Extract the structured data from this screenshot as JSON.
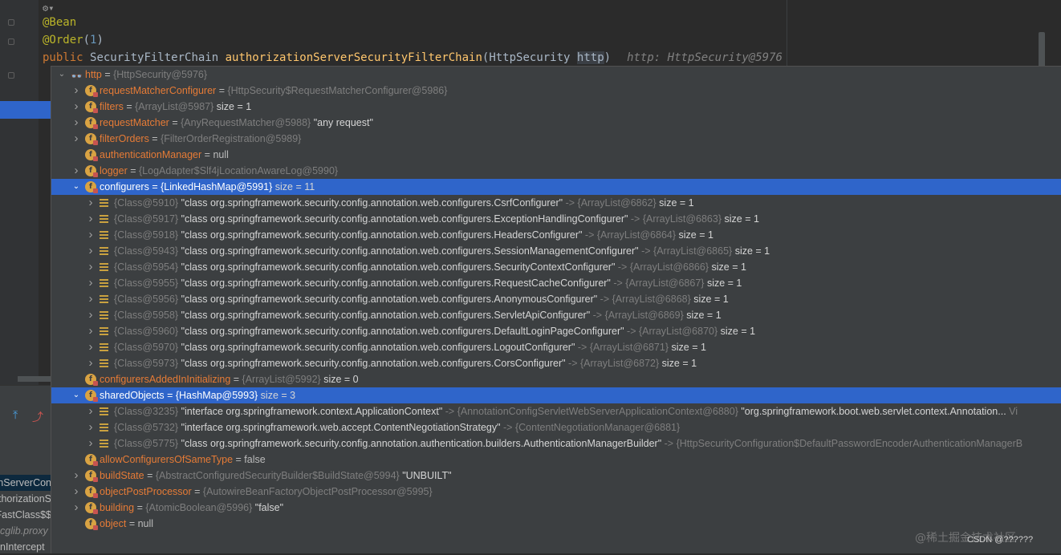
{
  "editor": {
    "lines": [
      {
        "id": "bean",
        "parts": [
          {
            "t": "@Bean",
            "c": "ann"
          }
        ]
      },
      {
        "id": "order",
        "parts": [
          {
            "t": "@Order",
            "c": "ann"
          },
          {
            "t": "(",
            "c": ""
          },
          {
            "t": "1",
            "c": "num"
          },
          {
            "t": ")",
            "c": ""
          }
        ]
      },
      {
        "id": "signature",
        "parts": [
          {
            "t": "public ",
            "c": "kw"
          },
          {
            "t": "SecurityFilterChain ",
            "c": ""
          },
          {
            "t": "authorizationServerSecurityFilterChain",
            "c": "fn"
          },
          {
            "t": "(HttpSecurity ",
            "c": ""
          },
          {
            "t": "http",
            "c": "param-hl"
          },
          {
            "t": ")",
            "c": ""
          },
          {
            "t": "http: HttpSecurity@5976",
            "c": "hint"
          }
        ]
      }
    ]
  },
  "stack_frames": [
    {
      "text": "nServerCon",
      "selected": true,
      "lib": false
    },
    {
      "text": "thorizationS",
      "selected": false,
      "lib": false
    },
    {
      "text": "FastClass$$",
      "selected": false,
      "lib": false
    },
    {
      "text": "cglib.proxy",
      "selected": false,
      "lib": true
    },
    {
      "text": "nIntercept",
      "selected": false,
      "lib": false
    }
  ],
  "tree": [
    {
      "depth": 0,
      "exp": "down",
      "icon": "glasses",
      "name": "http",
      "type": "{HttpSecurity@5976}",
      "tail": "",
      "sel": false
    },
    {
      "depth": 1,
      "exp": "right",
      "icon": "field",
      "name": "requestMatcherConfigurer",
      "type": "{HttpSecurity$RequestMatcherConfigurer@5986}",
      "tail": "",
      "sel": false
    },
    {
      "depth": 1,
      "exp": "right",
      "icon": "field",
      "name": "filters",
      "type": "{ArrayList@5987}",
      "tail": "size = 1",
      "sel": false
    },
    {
      "depth": 1,
      "exp": "right",
      "icon": "field",
      "name": "requestMatcher",
      "type": "{AnyRequestMatcher@5988}",
      "tail": "\"any request\"",
      "sel": false
    },
    {
      "depth": 1,
      "exp": "right",
      "icon": "field",
      "name": "filterOrders",
      "type": "{FilterOrderRegistration@5989}",
      "tail": "",
      "sel": false
    },
    {
      "depth": 1,
      "exp": "",
      "icon": "field",
      "name": "authenticationManager",
      "type": "",
      "tail": "null",
      "sel": false
    },
    {
      "depth": 1,
      "exp": "right",
      "icon": "field",
      "name": "logger",
      "type": "{LogAdapter$Slf4jLocationAwareLog@5990}",
      "tail": "",
      "sel": false
    },
    {
      "depth": 1,
      "exp": "down",
      "icon": "field",
      "name": "configurers",
      "type": "{LinkedHashMap@5991}",
      "tail": "size = 11",
      "sel": true
    },
    {
      "depth": 2,
      "exp": "right",
      "icon": "entry",
      "key": "{Class@5910}",
      "val": "\"class org.springframework.security.config.annotation.web.configurers.CsrfConfigurer\"",
      "arr": "{ArrayList@6862}",
      "size": "size = 1"
    },
    {
      "depth": 2,
      "exp": "right",
      "icon": "entry",
      "key": "{Class@5917}",
      "val": "\"class org.springframework.security.config.annotation.web.configurers.ExceptionHandlingConfigurer\"",
      "arr": "{ArrayList@6863}",
      "size": "size = 1"
    },
    {
      "depth": 2,
      "exp": "right",
      "icon": "entry",
      "key": "{Class@5918}",
      "val": "\"class org.springframework.security.config.annotation.web.configurers.HeadersConfigurer\"",
      "arr": "{ArrayList@6864}",
      "size": "size = 1"
    },
    {
      "depth": 2,
      "exp": "right",
      "icon": "entry",
      "key": "{Class@5943}",
      "val": "\"class org.springframework.security.config.annotation.web.configurers.SessionManagementConfigurer\"",
      "arr": "{ArrayList@6865}",
      "size": "size = 1"
    },
    {
      "depth": 2,
      "exp": "right",
      "icon": "entry",
      "key": "{Class@5954}",
      "val": "\"class org.springframework.security.config.annotation.web.configurers.SecurityContextConfigurer\"",
      "arr": "{ArrayList@6866}",
      "size": "size = 1"
    },
    {
      "depth": 2,
      "exp": "right",
      "icon": "entry",
      "key": "{Class@5955}",
      "val": "\"class org.springframework.security.config.annotation.web.configurers.RequestCacheConfigurer\"",
      "arr": "{ArrayList@6867}",
      "size": "size = 1"
    },
    {
      "depth": 2,
      "exp": "right",
      "icon": "entry",
      "key": "{Class@5956}",
      "val": "\"class org.springframework.security.config.annotation.web.configurers.AnonymousConfigurer\"",
      "arr": "{ArrayList@6868}",
      "size": "size = 1"
    },
    {
      "depth": 2,
      "exp": "right",
      "icon": "entry",
      "key": "{Class@5958}",
      "val": "\"class org.springframework.security.config.annotation.web.configurers.ServletApiConfigurer\"",
      "arr": "{ArrayList@6869}",
      "size": "size = 1"
    },
    {
      "depth": 2,
      "exp": "right",
      "icon": "entry",
      "key": "{Class@5960}",
      "val": "\"class org.springframework.security.config.annotation.web.configurers.DefaultLoginPageConfigurer\"",
      "arr": "{ArrayList@6870}",
      "size": "size = 1"
    },
    {
      "depth": 2,
      "exp": "right",
      "icon": "entry",
      "key": "{Class@5970}",
      "val": "\"class org.springframework.security.config.annotation.web.configurers.LogoutConfigurer\"",
      "arr": "{ArrayList@6871}",
      "size": "size = 1"
    },
    {
      "depth": 2,
      "exp": "right",
      "icon": "entry",
      "key": "{Class@5973}",
      "val": "\"class org.springframework.security.config.annotation.web.configurers.CorsConfigurer\"",
      "arr": "{ArrayList@6872}",
      "size": "size = 1"
    },
    {
      "depth": 1,
      "exp": "",
      "icon": "field",
      "name": "configurersAddedInInitializing",
      "type": "{ArrayList@5992}",
      "tail": "size = 0",
      "sel": false
    },
    {
      "depth": 1,
      "exp": "down",
      "icon": "field",
      "name": "sharedObjects",
      "type": "{HashMap@5993}",
      "tail": "size = 3",
      "sel": true
    },
    {
      "depth": 2,
      "exp": "right",
      "icon": "entry",
      "key": "{Class@3235}",
      "val": "\"interface org.springframework.context.ApplicationContext\"",
      "arr": "{AnnotationConfigServletWebServerApplicationContext@6880}",
      "size": "\"org.springframework.boot.web.servlet.context.Annotation...",
      "more": "Vi"
    },
    {
      "depth": 2,
      "exp": "right",
      "icon": "entry",
      "key": "{Class@5732}",
      "val": "\"interface org.springframework.web.accept.ContentNegotiationStrategy\"",
      "arr": "{ContentNegotiationManager@6881}",
      "size": ""
    },
    {
      "depth": 2,
      "exp": "right",
      "icon": "entry",
      "key": "{Class@5775}",
      "val": "\"class org.springframework.security.config.annotation.authentication.builders.AuthenticationManagerBuilder\"",
      "arr": "{HttpSecurityConfiguration$DefaultPasswordEncoderAuthenticationManagerB",
      "size": ""
    },
    {
      "depth": 1,
      "exp": "",
      "icon": "field",
      "name": "allowConfigurersOfSameType",
      "type": "",
      "tail": "false",
      "sel": false
    },
    {
      "depth": 1,
      "exp": "right",
      "icon": "field",
      "name": "buildState",
      "type": "{AbstractConfiguredSecurityBuilder$BuildState@5994}",
      "tail": "\"UNBUILT\"",
      "sel": false
    },
    {
      "depth": 1,
      "exp": "right",
      "icon": "field",
      "name": "objectPostProcessor",
      "type": "{AutowireBeanFactoryObjectPostProcessor@5995}",
      "tail": "",
      "sel": false
    },
    {
      "depth": 1,
      "exp": "right",
      "icon": "field",
      "name": "building",
      "type": "{AtomicBoolean@5996}",
      "tail": "\"false\"",
      "sel": false
    },
    {
      "depth": 1,
      "exp": "",
      "icon": "field",
      "name": "object",
      "type": "",
      "tail": "null",
      "sel": false
    }
  ],
  "watermark": "@稀土掘金技术社区",
  "corner_label": "CSDN @??????"
}
